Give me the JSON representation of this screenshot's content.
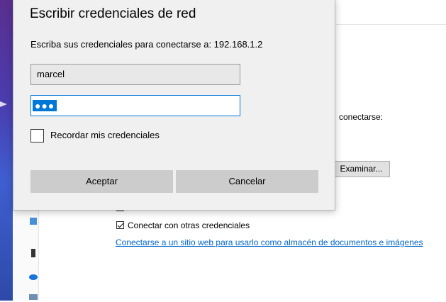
{
  "dialog": {
    "title": "Escribir credenciales de red",
    "prompt": "Escriba sus credenciales para conectarse a: 192.168.1.2",
    "username_value": "marcel",
    "password_mask": "●●●",
    "remember_label": "Recordar mis credenciales",
    "remember_checked": false,
    "ok_label": "Aceptar",
    "cancel_label": "Cancelar"
  },
  "background": {
    "connect_text": "conectarse:",
    "browse_label": "Examinar...",
    "other_credentials_label": "Conectar con otras credenciales",
    "other_credentials_checked": true,
    "website_link": "Conectarse a un sitio web para usarlo como almacén de documentos e imágenes",
    "period": "."
  },
  "colors": {
    "accent": "#0078d7",
    "dialog_bg": "#f0f0f0",
    "button_bg": "#cccccc",
    "link": "#0066cc"
  }
}
